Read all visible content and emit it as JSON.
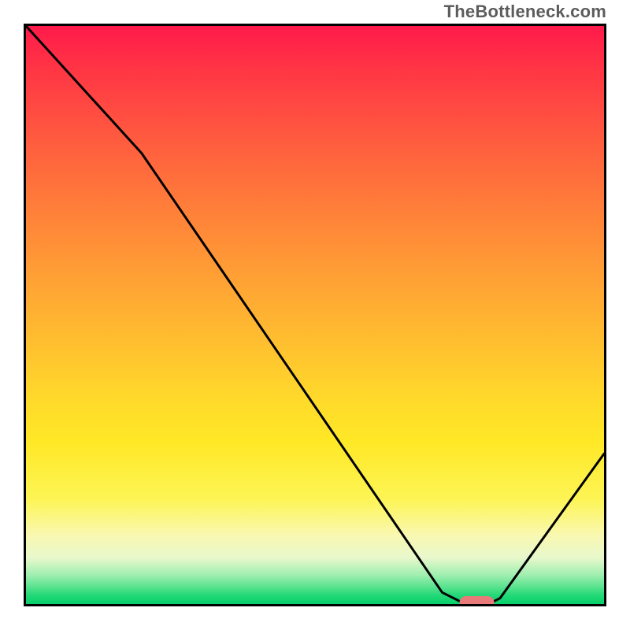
{
  "watermark": "TheBottleneck.com",
  "chart_data": {
    "type": "line",
    "title": "",
    "xlabel": "",
    "ylabel": "",
    "xlim": [
      0,
      100
    ],
    "ylim": [
      0,
      100
    ],
    "grid": false,
    "legend": false,
    "series": [
      {
        "name": "curve",
        "x": [
          0,
          20,
          72,
          76,
          80,
          82,
          100
        ],
        "values": [
          100,
          78,
          2,
          0,
          0,
          1,
          26
        ]
      }
    ],
    "annotations": [
      {
        "name": "marker",
        "type": "pill",
        "x": 78,
        "y": 0,
        "width_pct": 6,
        "color": "#e97a7a"
      }
    ],
    "background": {
      "type": "vertical-gradient",
      "stops": [
        {
          "pos": 0,
          "color": "#ff1a4b"
        },
        {
          "pos": 18,
          "color": "#ff5640"
        },
        {
          "pos": 42,
          "color": "#ff9c35"
        },
        {
          "pos": 64,
          "color": "#ffd82b"
        },
        {
          "pos": 88,
          "color": "#f9f8b0"
        },
        {
          "pos": 100,
          "color": "#07d06a"
        }
      ]
    }
  }
}
